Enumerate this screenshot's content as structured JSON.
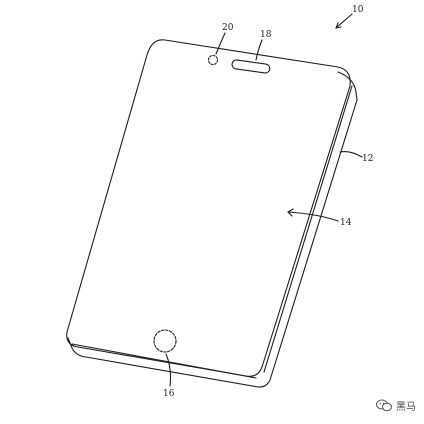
{
  "labels": {
    "device": "10",
    "housing": "12",
    "display": "14",
    "button": "16",
    "speaker": "18",
    "camera": "20"
  },
  "watermark": {
    "icon": "wechat-icon",
    "text": "黑马"
  },
  "colors": {
    "line": "#1e1e1e",
    "background": "#ffffff"
  }
}
